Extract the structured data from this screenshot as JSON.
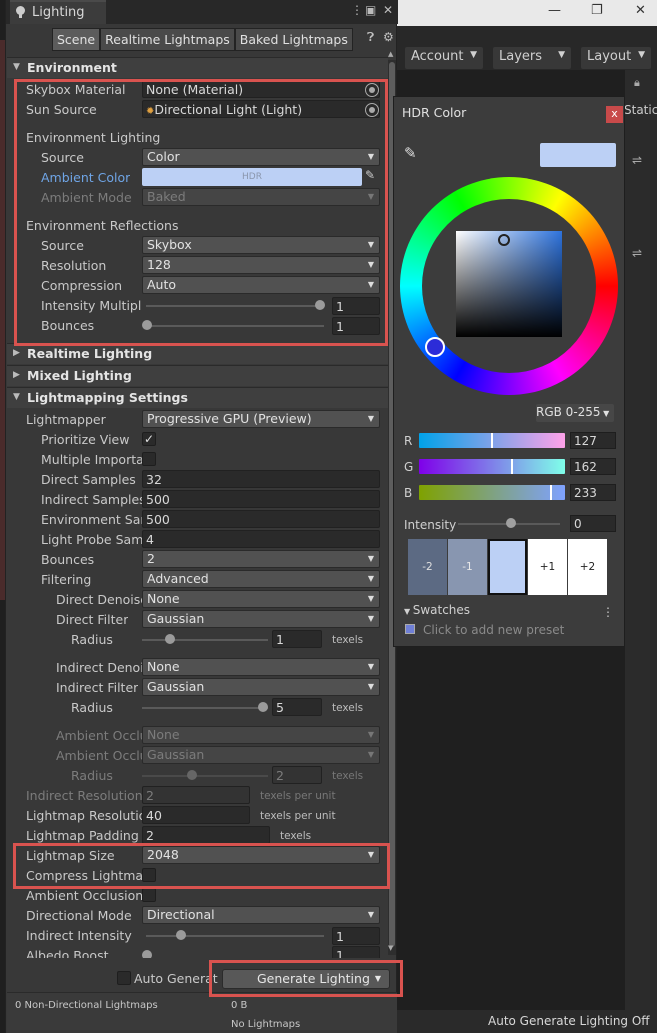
{
  "window": {
    "tab_title": "Lighting",
    "subtabs": [
      "Scene",
      "Realtime Lightmaps",
      "Baked Lightmaps"
    ]
  },
  "background": {
    "account": "Account",
    "layers": "Layers",
    "layout": "Layout",
    "static_label": "Static",
    "status_text": "Auto Generate Lighting Off"
  },
  "environment": {
    "header": "Environment",
    "skybox_label": "Skybox Material",
    "skybox_value": "None (Material)",
    "sun_label": "Sun Source",
    "sun_value": "Directional Light (Light)",
    "env_lighting_header": "Environment Lighting",
    "source_label": "Source",
    "source_value": "Color",
    "ambient_color_label": "Ambient Color",
    "ambient_color_text": "HDR",
    "ambient_color_hex": "#7fa2e9",
    "ambient_mode_label": "Ambient Mode",
    "ambient_mode_value": "Baked",
    "env_reflections_header": "Environment Reflections",
    "refl_source_label": "Source",
    "refl_source_value": "Skybox",
    "resolution_label": "Resolution",
    "resolution_value": "128",
    "compression_label": "Compression",
    "compression_value": "Auto",
    "intensity_label": "Intensity Multiplie",
    "intensity_value": "1",
    "bounces_label": "Bounces",
    "bounces_value": "1"
  },
  "realtime_lighting": {
    "header": "Realtime Lighting"
  },
  "mixed_lighting": {
    "header": "Mixed Lighting"
  },
  "lightmapping": {
    "header": "Lightmapping Settings",
    "lightmapper_label": "Lightmapper",
    "lightmapper_value": "Progressive GPU (Preview)",
    "prioritize_label": "Prioritize View",
    "prioritize_checked": "✓",
    "mis_label": "Multiple Importanc",
    "direct_samples_label": "Direct Samples",
    "direct_samples_value": "32",
    "indirect_samples_label": "Indirect Samples",
    "indirect_samples_value": "500",
    "env_samples_label": "Environment Sam",
    "env_samples_value": "500",
    "probe_samples_label": "Light Probe Samp",
    "probe_samples_value": "4",
    "bounces_label": "Bounces",
    "bounces_value": "2",
    "filtering_label": "Filtering",
    "filtering_value": "Advanced",
    "direct_denoiser_label": "Direct Denoise",
    "direct_denoiser_value": "None",
    "direct_filter_label": "Direct Filter",
    "direct_filter_value": "Gaussian",
    "direct_radius_label": "Radius",
    "direct_radius_value": "1",
    "direct_radius_unit": "texels",
    "indirect_denoiser_label": "Indirect Denois",
    "indirect_denoiser_value": "None",
    "indirect_filter_label": "Indirect Filter",
    "indirect_filter_value": "Gaussian",
    "indirect_radius_label": "Radius",
    "indirect_radius_value": "5",
    "indirect_radius_unit": "texels",
    "ao_denoiser_label": "Ambient Occlus",
    "ao_denoiser_value": "None",
    "ao_filter_label": "Ambient Occlus",
    "ao_filter_value": "Gaussian",
    "ao_radius_label": "Radius",
    "ao_radius_value": "2",
    "ao_radius_unit": "texels",
    "indirect_res_label": "Indirect Resolution",
    "indirect_res_value": "2",
    "indirect_res_unit": "texels per unit",
    "lightmap_res_label": "Lightmap Resolution",
    "lightmap_res_value": "40",
    "lightmap_res_unit": "texels per unit",
    "padding_label": "Lightmap Padding",
    "padding_value": "2",
    "padding_unit": "texels",
    "size_label": "Lightmap Size",
    "size_value": "2048",
    "compress_label": "Compress Lightmaps",
    "ao_label": "Ambient Occlusion",
    "directional_label": "Directional Mode",
    "directional_value": "Directional",
    "indirect_intensity_label": "Indirect Intensity",
    "indirect_intensity_value": "1",
    "albedo_label": "Albedo Boost",
    "albedo_value": "1"
  },
  "footer": {
    "auto_generate_label": "Auto Generat",
    "generate_button": "Generate Lighting",
    "stat_left": "0 Non-Directional Lightmaps",
    "stat_size": "0 B",
    "stat_none": "No Lightmaps"
  },
  "hdr_color": {
    "title": "HDR Color",
    "close": "x",
    "mode": "RGB 0-255",
    "r_label": "R",
    "r_value": "127",
    "r_fraction": 0.5,
    "g_label": "G",
    "g_value": "162",
    "g_fraction": 0.64,
    "b_label": "B",
    "b_value": "233",
    "b_fraction": 0.91,
    "intensity_label": "Intensity",
    "intensity_value": "0",
    "exposure": [
      "-2",
      "-1",
      "",
      "+1",
      "+2"
    ],
    "swatches_label": "Swatches",
    "preset_hint": "Click to add new preset",
    "current_color": "#bcd0f5"
  }
}
